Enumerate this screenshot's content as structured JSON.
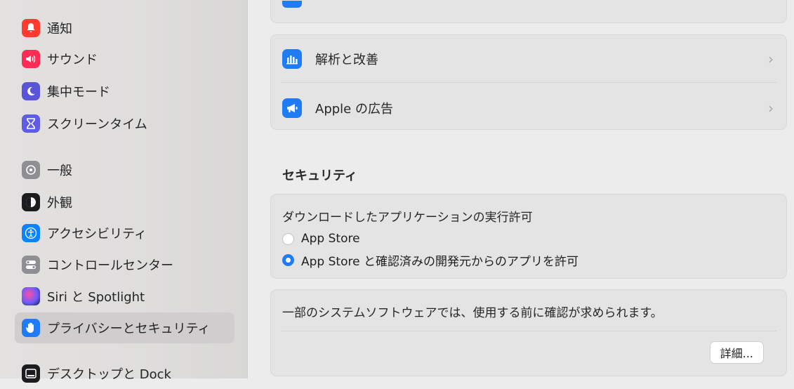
{
  "sidebar": {
    "items": [
      {
        "label": "通知",
        "icon": "bell-icon",
        "color": "#ff3b30"
      },
      {
        "label": "サウンド",
        "icon": "speaker-icon",
        "color": "#ff2d55"
      },
      {
        "label": "集中モード",
        "icon": "moon-icon",
        "color": "#5856d6"
      },
      {
        "label": "スクリーンタイム",
        "icon": "hourglass-icon",
        "color": "#5e5ce6"
      },
      {
        "label": "一般",
        "icon": "gear-icon",
        "color": "#8e8e93"
      },
      {
        "label": "外観",
        "icon": "appearance-icon",
        "color": "#1c1c1e"
      },
      {
        "label": "アクセシビリティ",
        "icon": "accessibility-icon",
        "color": "#0a84ff"
      },
      {
        "label": "コントロールセンター",
        "icon": "toggles-icon",
        "color": "#8e8e93"
      },
      {
        "label": "Siri と Spotlight",
        "icon": "siri-icon",
        "color": "#3a3a8c"
      },
      {
        "label": "プライバシーとセキュリティ",
        "icon": "hand-icon",
        "color": "#1f7cf6"
      },
      {
        "label": "デスクトップと Dock",
        "icon": "dock-icon",
        "color": "#1c1c1e"
      }
    ],
    "active_index": 9
  },
  "main": {
    "rows": [
      {
        "label": "解析と改善",
        "icon": "analytics-icon"
      },
      {
        "label": "Apple の広告",
        "icon": "megaphone-icon"
      }
    ],
    "security_title": "セキュリティ",
    "allow_apps": {
      "label": "ダウンロードしたアプリケーションの実行許可",
      "options": [
        "App Store",
        "App Store と確認済みの開発元からのアプリを許可"
      ],
      "selected_index": 1
    },
    "system_software": {
      "text": "一部のシステムソフトウェアでは、使用する前に確認が求められます。",
      "details_button": "詳細..."
    }
  },
  "colors": {
    "accent": "#1f7cf6"
  }
}
